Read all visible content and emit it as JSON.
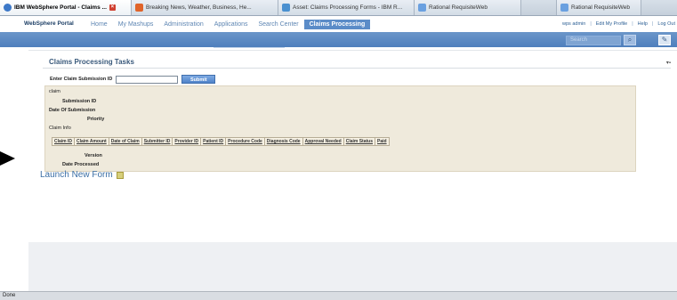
{
  "browser": {
    "tabs": [
      {
        "label": "IBM WebSphere Portal - Claims ...",
        "active": true,
        "icon": "ibm-globe-icon",
        "icon_color": "#3c78c8"
      },
      {
        "label": "Breaking News, Weather, Business, He...",
        "active": false,
        "icon": "news-icon",
        "icon_color": "#e0642a"
      },
      {
        "label": "Asset: Claims Processing Forms - IBM R...",
        "active": false,
        "icon": "asset-icon",
        "icon_color": "#4a90d0"
      },
      {
        "label": "Rational RequisiteWeb",
        "active": false,
        "icon": "page-icon",
        "icon_color": "#6aa0e0"
      },
      {
        "label": "Rational RequisiteWeb",
        "active": false,
        "icon": "page-icon",
        "icon_color": "#6aa0e0"
      }
    ],
    "status": "Done"
  },
  "header": {
    "brand": "WebSphere Portal",
    "nav": [
      {
        "label": "Home",
        "active": false
      },
      {
        "label": "My Mashups",
        "active": false
      },
      {
        "label": "Administration",
        "active": false
      },
      {
        "label": "Applications",
        "active": false
      },
      {
        "label": "Search Center",
        "active": false
      },
      {
        "label": "Claims Processing",
        "active": true
      }
    ],
    "utility": {
      "user": "wps admin",
      "profile": "Edit My Profile",
      "help": "Help",
      "logout": "Log Out"
    },
    "search_placeholder": "Search"
  },
  "portlet": {
    "title": "Claims Processing Tasks",
    "lookup_label": "Enter Claim Submission ID",
    "submit_label": "Submit",
    "result": {
      "heading": "claim",
      "fields_top": [
        {
          "label": "Submission ID",
          "indent": true
        },
        {
          "label": "Date Of Submission",
          "indent": false
        },
        {
          "label": "Priority",
          "indent": true
        }
      ],
      "claim_info_label": "Claim Info",
      "table_columns": [
        "Claim ID",
        "Claim Amount",
        "Date of Claim",
        "Submitter ID",
        "Provider ID",
        "Patient ID",
        "Procedure Code",
        "Diagnosis Code",
        "Approval Needed",
        "Claim Status",
        "Paid"
      ],
      "fields_bottom": [
        {
          "label": "Version",
          "indent": true
        },
        {
          "label": "Date Processed",
          "indent": false
        }
      ]
    },
    "launch_label": "Launch New Form"
  },
  "colors": {
    "accent_blue": "#5b8cc8",
    "band_blue": "#4f7fbd",
    "result_bg": "#efeadc"
  }
}
